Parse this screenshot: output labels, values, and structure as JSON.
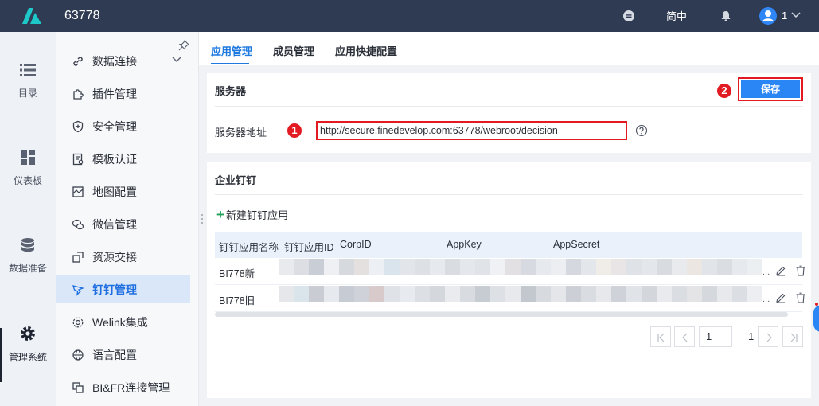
{
  "topbar": {
    "title": "63778",
    "lang": "简中",
    "user": "1"
  },
  "rail": {
    "items": [
      {
        "label": "目录",
        "icon": "list-icon"
      },
      {
        "label": "仪表板",
        "icon": "dashboard-icon"
      },
      {
        "label": "数据准备",
        "icon": "database-icon"
      },
      {
        "label": "管理系统",
        "icon": "gear-icon"
      }
    ]
  },
  "sidebar": {
    "items": [
      {
        "label": "数据连接",
        "icon": "link-icon"
      },
      {
        "label": "插件管理",
        "icon": "puzzle-icon"
      },
      {
        "label": "安全管理",
        "icon": "shield-icon"
      },
      {
        "label": "模板认证",
        "icon": "certificate-icon"
      },
      {
        "label": "地图配置",
        "icon": "map-icon"
      },
      {
        "label": "微信管理",
        "icon": "wechat-icon"
      },
      {
        "label": "资源交接",
        "icon": "handover-icon"
      },
      {
        "label": "钉钉管理",
        "icon": "dingtalk-icon"
      },
      {
        "label": "Welink集成",
        "icon": "welink-icon"
      },
      {
        "label": "语言配置",
        "icon": "globe-icon"
      },
      {
        "label": "BI&FR连接管理",
        "icon": "connection-icon"
      }
    ],
    "active_index": 7
  },
  "tabs": [
    "应用管理",
    "成员管理",
    "应用快捷配置"
  ],
  "server": {
    "title": "服务器",
    "save_label": "保存",
    "field_label": "服务器地址",
    "url": "http://secure.finedevelop.com:63778/webroot/decision",
    "badge_url": "1",
    "badge_save": "2"
  },
  "dingtalk": {
    "title": "企业钉钉",
    "new_label": "新建钉钉应用",
    "columns": [
      "钉钉应用名称",
      "钉钉应用ID",
      "CorpID",
      "AppKey",
      "AppSecret"
    ],
    "rows": [
      {
        "name": "BI778新",
        "actions": "..."
      },
      {
        "name": "BI778旧",
        "actions": "..."
      }
    ]
  },
  "pagination": {
    "current_page": "1",
    "total_pages": "1"
  },
  "colors": {
    "accent": "#1f7ae0",
    "highlight": "#e21b23",
    "topbar": "#2f3b52"
  }
}
